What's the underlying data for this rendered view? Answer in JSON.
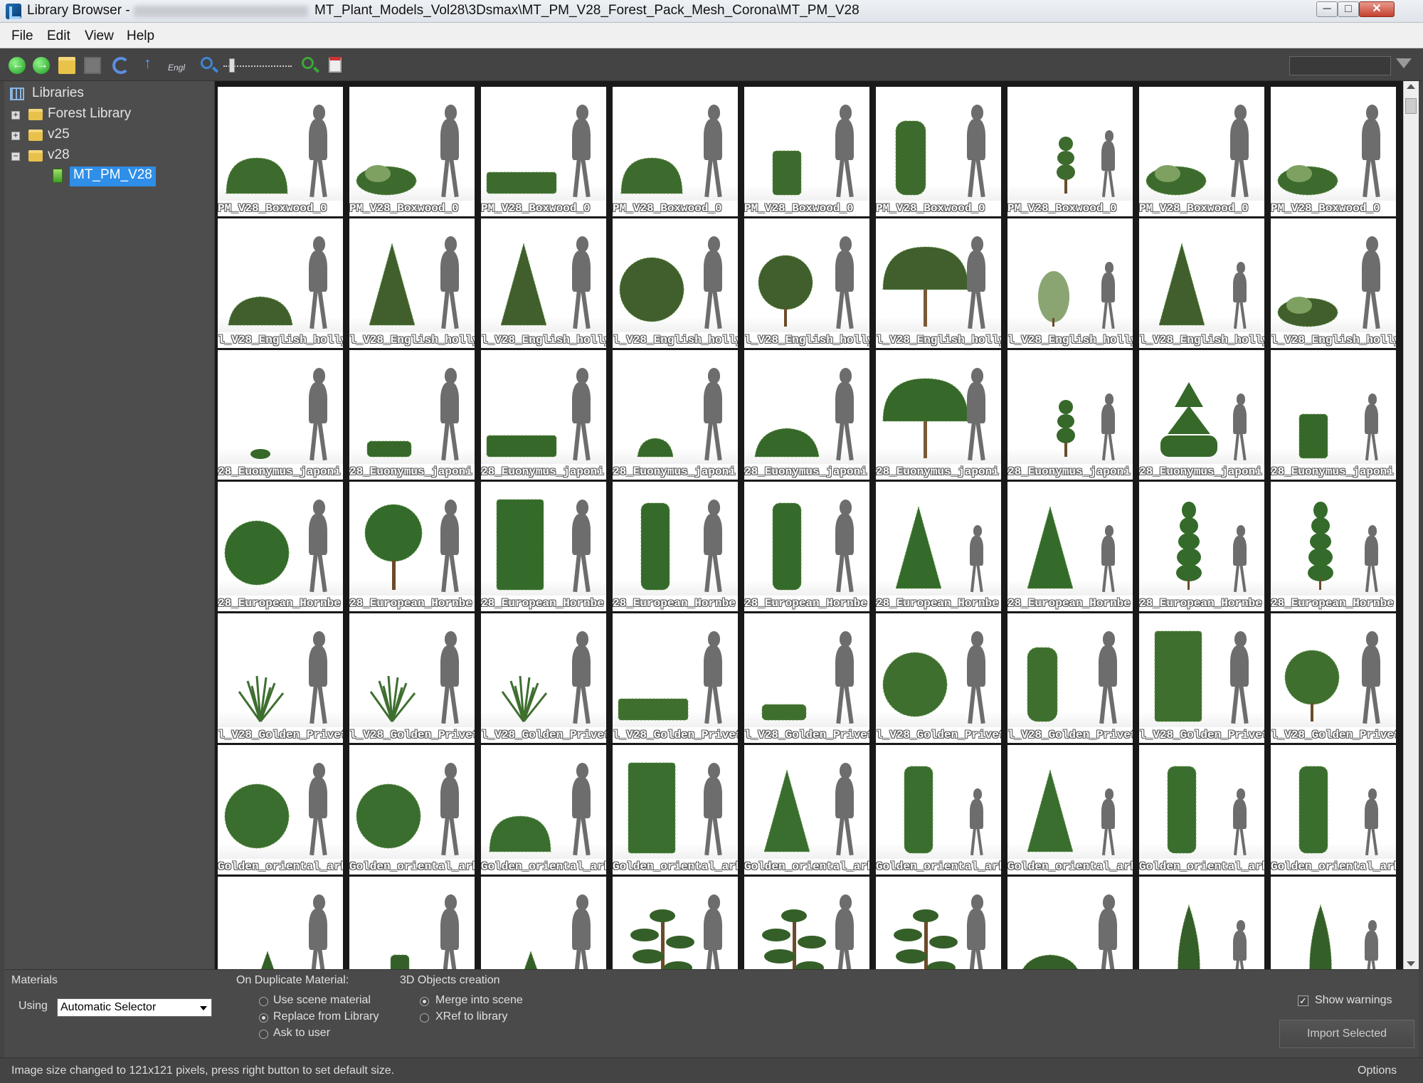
{
  "window": {
    "title_prefix": "Library Browser -",
    "title_path": "MT_Plant_Models_Vol28\\3Dsmax\\MT_PM_V28_Forest_Pack_Mesh_Corona\\MT_PM_V28",
    "caption_buttons": {
      "minimize": "─",
      "maximize": "□",
      "close": "✕"
    }
  },
  "menu": [
    "File",
    "Edit",
    "View",
    "Help"
  ],
  "toolbar": {
    "engl_label": "Engl",
    "search_value": ""
  },
  "tree": {
    "root": "Libraries",
    "items": [
      {
        "label": "Forest Library",
        "expander": "+"
      },
      {
        "label": "v25",
        "expander": "+"
      },
      {
        "label": "v28",
        "expander": "−"
      }
    ],
    "selected": "MT_PM_V28"
  },
  "grid": {
    "rows": [
      {
        "label": "PM_V28_Boxwood_0",
        "color": "#3d6b2e"
      },
      {
        "label": "l_V28_English_holly",
        "color": "#405f2c"
      },
      {
        "label": "28_Euonymus_japoni",
        "color": "#36682a"
      },
      {
        "label": "28_European_Hornbe",
        "color": "#346b2b"
      },
      {
        "label": "l_V28_Golden_Privet",
        "color": "#3e6f2f"
      },
      {
        "label": "Golden_oriental_arbo",
        "color": "#3a6e2f"
      },
      {
        "label": "",
        "color": "#355f28"
      }
    ],
    "shapes": [
      [
        "dome",
        "bush",
        "hedge",
        "dome",
        "box",
        "pillar",
        "topiary",
        "bush",
        "bush"
      ],
      [
        "halfdome",
        "cone",
        "cone",
        "ball",
        "balltree",
        "umbrella",
        "shrub",
        "cone",
        "bush"
      ],
      [
        "tiny",
        "lowbush",
        "hedge",
        "halfsmall",
        "halfdome",
        "umbrella",
        "topiary",
        "tiered",
        "box"
      ],
      [
        "ball",
        "tree",
        "tallbox",
        "column",
        "column",
        "cone",
        "cone",
        "spiral",
        "spiral"
      ],
      [
        "grass",
        "grass",
        "grass",
        "hedge",
        "lowbush",
        "ball",
        "pillar",
        "tallbox",
        "balltree"
      ],
      [
        "ball",
        "ball",
        "dome",
        "tallbox",
        "cone",
        "column",
        "cone",
        "column",
        "column"
      ],
      [
        "smallcone",
        "smallcolumn",
        "smallcone",
        "bonsai",
        "bonsai",
        "bonsai",
        "halfdome",
        "cypress",
        "cypress"
      ]
    ]
  },
  "options": {
    "materials_label": "Materials",
    "using_label": "Using",
    "using_value": "Automatic Selector",
    "duplicate_label": "On Duplicate Material:",
    "duplicate_options": [
      "Use scene material",
      "Replace from Library",
      "Ask to user"
    ],
    "duplicate_selected": 1,
    "creation_label": "3D Objects creation",
    "creation_options": [
      "Merge into scene",
      "XRef to library"
    ],
    "creation_selected": 0,
    "show_warnings": "Show warnings",
    "import_button": "Import Selected"
  },
  "status": {
    "text": "Image size changed to 121x121 pixels, press right button to set default size.",
    "options_button": "Options"
  }
}
